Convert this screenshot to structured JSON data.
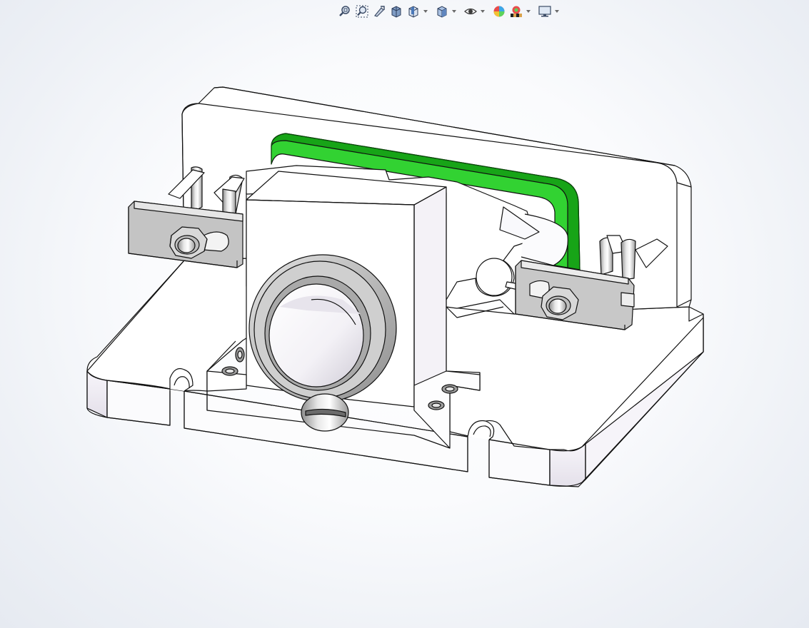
{
  "view": {
    "toolbar": {
      "tools": [
        {
          "icon": "zoom-to-fit-icon",
          "has_dropdown": false
        },
        {
          "icon": "zoom-to-area-icon",
          "has_dropdown": false
        },
        {
          "icon": "previous-view-icon",
          "has_dropdown": false
        },
        {
          "icon": "section-view-icon",
          "has_dropdown": false
        },
        {
          "icon": "view-orientation-icon",
          "has_dropdown": true
        },
        {
          "icon": "display-style-icon",
          "has_dropdown": true
        },
        {
          "icon": "hide-show-items-icon",
          "has_dropdown": true
        },
        {
          "icon": "edit-appearance-icon",
          "has_dropdown": false
        },
        {
          "icon": "apply-scene-icon",
          "has_dropdown": true
        },
        {
          "icon": "view-settings-icon",
          "has_dropdown": true
        }
      ]
    },
    "colors": {
      "highlight_green": "#2fcf2f",
      "highlight_green_dark": "#159915",
      "model_outline": "#111111",
      "part_white": "#ffffff",
      "part_shade": "#e9e6ee",
      "metal_grey": "#bdbdbd",
      "metal_dark": "#7c7c7c"
    }
  }
}
